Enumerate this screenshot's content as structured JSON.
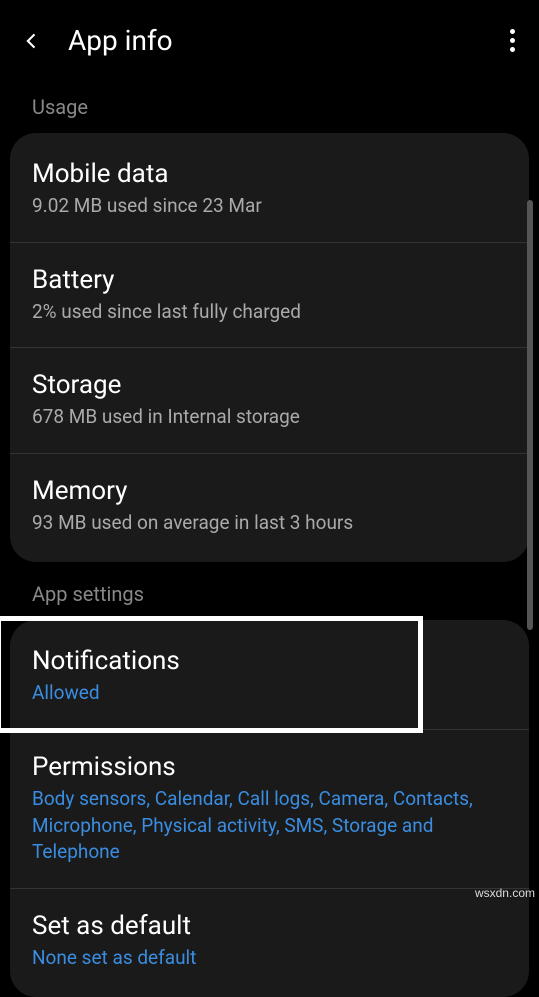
{
  "header": {
    "title": "App info"
  },
  "sections": {
    "usage": {
      "label": "Usage",
      "mobile_data": {
        "title": "Mobile data",
        "sub": "9.02 MB used since 23 Mar"
      },
      "battery": {
        "title": "Battery",
        "sub": "2% used since last fully charged"
      },
      "storage": {
        "title": "Storage",
        "sub": "678 MB used in Internal storage"
      },
      "memory": {
        "title": "Memory",
        "sub": "93 MB used on average in last 3 hours"
      }
    },
    "app_settings": {
      "label": "App settings",
      "notifications": {
        "title": "Notifications",
        "sub": "Allowed"
      },
      "permissions": {
        "title": "Permissions",
        "sub": "Body sensors, Calendar, Call logs, Camera, Contacts, Microphone, Physical activity, SMS, Storage and Telephone"
      },
      "set_as_default": {
        "title": "Set as default",
        "sub": "None set as default"
      }
    }
  },
  "watermark": "wsxdn.com"
}
